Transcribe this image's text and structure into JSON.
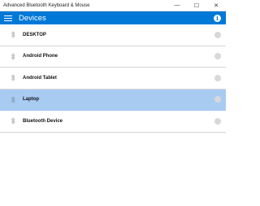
{
  "window": {
    "title": "Advanced Bluetooth Keyboard & Mouse",
    "controls": {
      "minimize": "—",
      "maximize": "☐",
      "close": "✕"
    }
  },
  "appbar": {
    "title": "Devices",
    "menu_icon": "hamburger-menu-icon",
    "info_icon": "info-icon",
    "info_glyph": "i"
  },
  "devices": [
    {
      "label": "DESKTOP",
      "selected": false,
      "icon": "bluetooth-icon"
    },
    {
      "label": "Android Phone",
      "selected": false,
      "icon": "bluetooth-icon"
    },
    {
      "label": "Android Tablet",
      "selected": false,
      "icon": "bluetooth-icon"
    },
    {
      "label": "Laptop",
      "selected": true,
      "icon": "bluetooth-icon"
    },
    {
      "label": "Bluetooth Device",
      "selected": false,
      "icon": "bluetooth-icon"
    }
  ],
  "colors": {
    "accent": "#0078d7",
    "selected_row": "#a8cbf2",
    "status_dot": "#d8d8d8"
  }
}
